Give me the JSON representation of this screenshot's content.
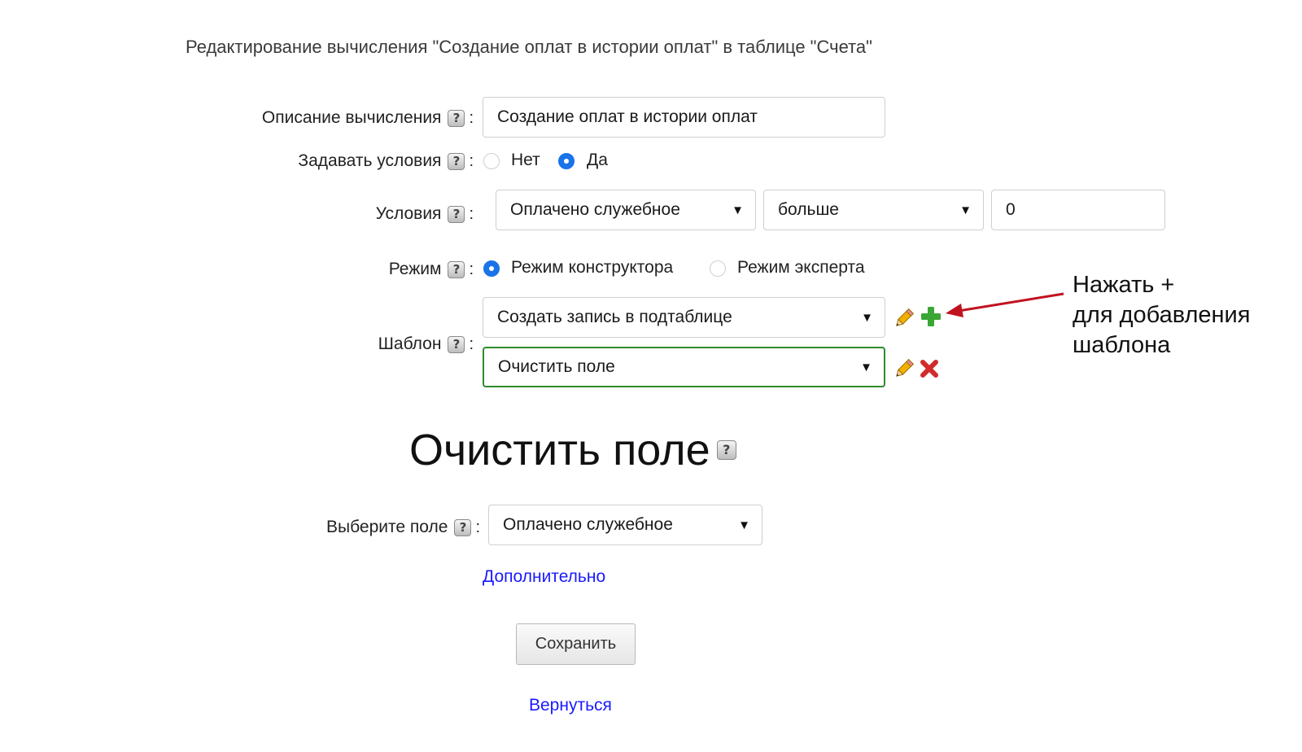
{
  "page_title": "Редактирование вычисления \"Создание оплат в истории оплат\" в таблице \"Счета\"",
  "form": {
    "description": {
      "label": "Описание вычисления",
      "value": "Создание оплат в истории оплат"
    },
    "set_conditions": {
      "label": "Задавать условия",
      "options": [
        "Нет",
        "Да"
      ],
      "selected": "Да"
    },
    "conditions": {
      "label": "Условия",
      "field": "Оплачено служебное",
      "operator": "больше",
      "value": "0"
    },
    "mode": {
      "label": "Режим",
      "options": [
        "Режим конструктора",
        "Режим эксперта"
      ],
      "selected": "Режим конструктора"
    },
    "template": {
      "label": "Шаблон",
      "items": [
        "Создать запись в подтаблице",
        "Очистить поле"
      ]
    }
  },
  "annotation": {
    "line1": "Нажать +",
    "line2": "для добавления",
    "line3": "шаблона",
    "arrow_color": "#c1121f"
  },
  "section": {
    "heading": "Очистить поле",
    "field_label": "Выберите поле",
    "field_value": "Оплачено служебное",
    "more_link": "Дополнительно"
  },
  "actions": {
    "save_label": "Сохранить",
    "back_link": "Вернуться"
  },
  "colors": {
    "accent": "#1a73e8",
    "link": "#1a1aff",
    "active_border": "#2e8b2e",
    "add_icon": "#3aa635",
    "delete_icon": "#d22b2b"
  },
  "icons": {
    "help": "help-icon",
    "edit": "pencil-icon",
    "add": "plus-icon",
    "delete": "delete-x-icon",
    "dropdown": "chevron-down-icon"
  }
}
